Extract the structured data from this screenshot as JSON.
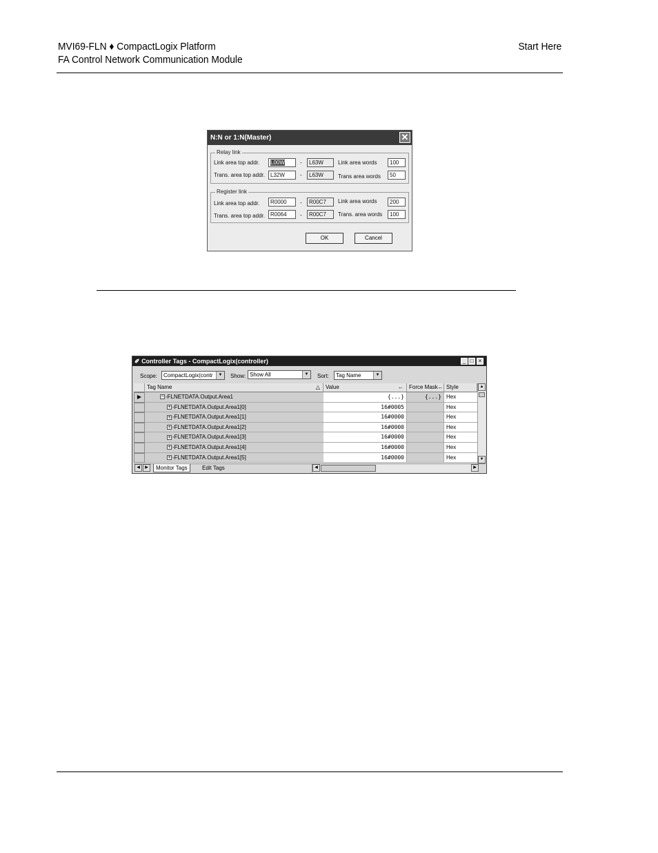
{
  "header": {
    "line1": "MVI69-FLN ♦ CompactLogix Platform",
    "line2": "FA Control Network Communication Module",
    "right": "Start Here"
  },
  "dialog": {
    "title": "N:N or 1:N(Master)",
    "close_glyph": "✕",
    "relay": {
      "legend": "Relay link",
      "link_top_label": "Link area top addr.",
      "link_top_value": "L00W",
      "link_end_value": "L63W",
      "link_words_label": "Link area words",
      "link_words_value": "100",
      "trans_top_label": "Trans. area top addr.",
      "trans_top_value": "L32W",
      "trans_end_value": "L63W",
      "trans_words_label": "Trans area words",
      "trans_words_value": "50"
    },
    "register": {
      "legend": "Register link",
      "link_top_label": "Link area top addr.",
      "link_top_value": "R0000",
      "link_end_value": "R00C7",
      "link_words_label": "Link area words",
      "link_words_value": "200",
      "trans_top_label": "Trans. area top addr.",
      "trans_top_value": "R0064",
      "trans_end_value": "R00C7",
      "trans_words_label": "Trans. area words",
      "trans_words_value": "100"
    },
    "dash": "-",
    "ok_label": "OK",
    "cancel_label": "Cancel"
  },
  "tags_window": {
    "title": "Controller Tags - CompactLogix(controller)",
    "title_icon": "✐",
    "scope_label": "Scope:",
    "scope_value": "CompactLogix(contr",
    "show_label": "Show:",
    "show_value": "Show All",
    "sort_label": "Sort:",
    "sort_value": "Tag Name",
    "columns": {
      "tag_name": "Tag Name",
      "tag_name_sort": "△",
      "value": "Value",
      "value_arrow": "←",
      "force_mask": "Force Mask",
      "force_arrow": "←",
      "style": "Style"
    },
    "rows": [
      {
        "marker": "▶",
        "expander": "−",
        "name": "-FLNETDATA.Output.Area1",
        "value": "{...}",
        "force": "{...}",
        "style": "Hex"
      },
      {
        "marker": "",
        "expander": "+",
        "name": "-FLNETDATA.Output.Area1[0]",
        "value": "16#0005",
        "force": "",
        "style": "Hex"
      },
      {
        "marker": "",
        "expander": "+",
        "name": "-FLNETDATA.Output.Area1[1]",
        "value": "16#0000",
        "force": "",
        "style": "Hex"
      },
      {
        "marker": "",
        "expander": "+",
        "name": "-FLNETDATA.Output.Area1[2]",
        "value": "16#0000",
        "force": "",
        "style": "Hex"
      },
      {
        "marker": "",
        "expander": "+",
        "name": "-FLNETDATA.Output.Area1[3]",
        "value": "16#0000",
        "force": "",
        "style": "Hex"
      },
      {
        "marker": "",
        "expander": "+",
        "name": "-FLNETDATA.Output.Area1[4]",
        "value": "16#0000",
        "force": "",
        "style": "Hex"
      },
      {
        "marker": "",
        "expander": "+",
        "name": "-FLNETDATA.Output.Area1[5]",
        "value": "16#0000",
        "force": "",
        "style": "Hex"
      }
    ],
    "tabs": {
      "monitor": "Monitor Tags",
      "edit": "Edit Tags"
    }
  }
}
